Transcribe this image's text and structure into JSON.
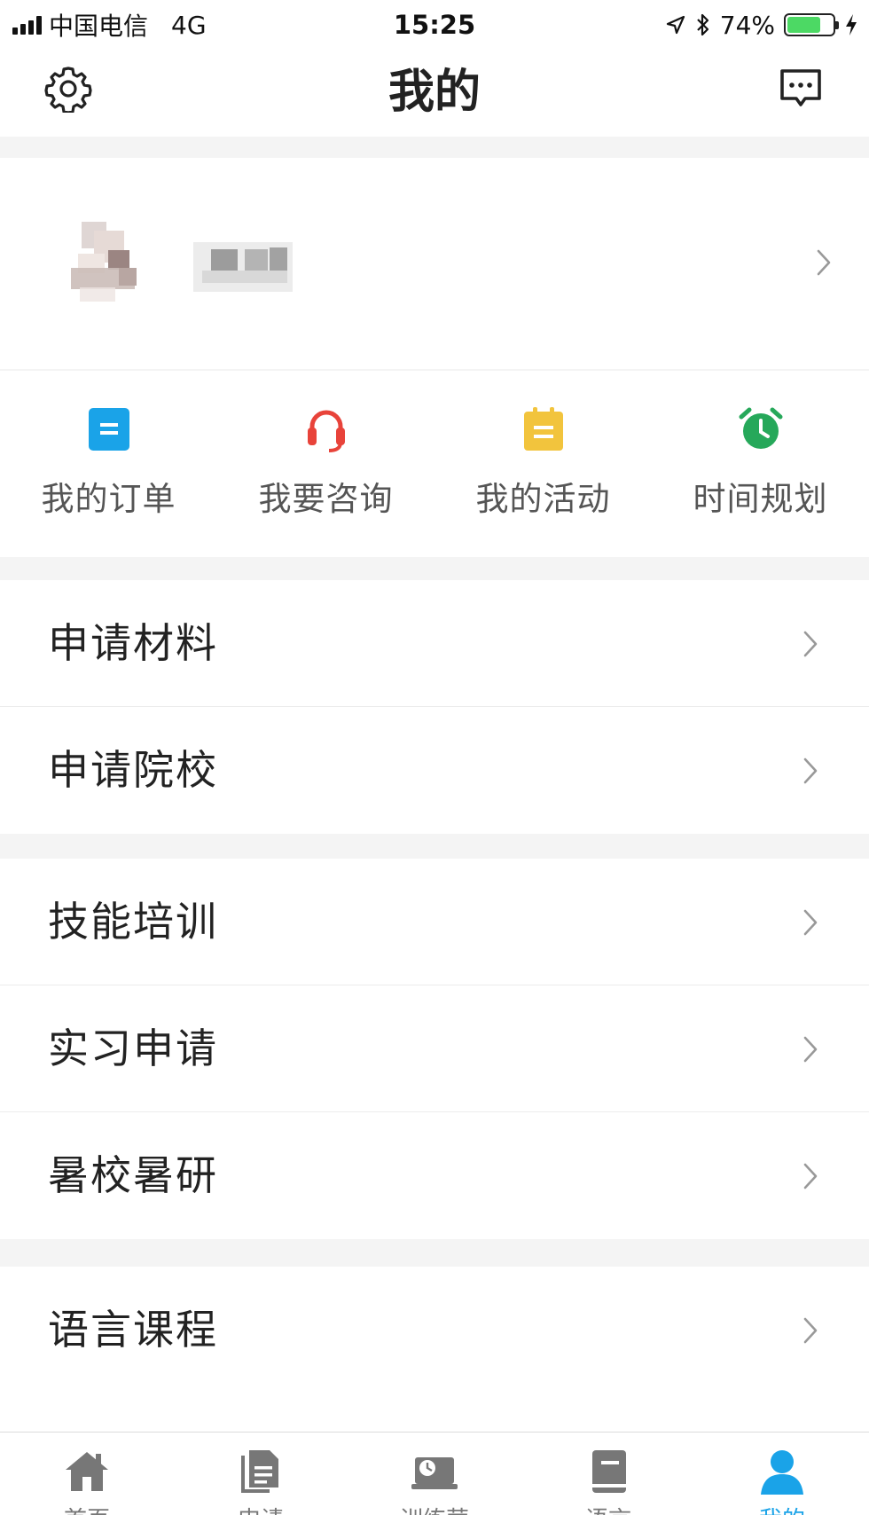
{
  "status_bar": {
    "carrier": "中国电信",
    "network": "4G",
    "time": "15:25",
    "battery": "74%",
    "battery_level": 0.74
  },
  "header": {
    "title": "我的",
    "settings_icon": "gear-icon",
    "message_icon": "message-icon"
  },
  "quick_actions": [
    {
      "label": "我的订单",
      "icon": "order-icon",
      "color": "#1aa3e8"
    },
    {
      "label": "我要咨询",
      "icon": "headset-icon",
      "color": "#e8433a"
    },
    {
      "label": "我的活动",
      "icon": "clipboard-icon",
      "color": "#f2c43d"
    },
    {
      "label": "时间规划",
      "icon": "alarm-clock-icon",
      "color": "#26a85a"
    }
  ],
  "menu_groups": [
    {
      "items": [
        "申请材料",
        "申请院校"
      ]
    },
    {
      "items": [
        "技能培训",
        "实习申请",
        "暑校暑研"
      ]
    },
    {
      "items": [
        "语言课程"
      ]
    }
  ],
  "tabbar": {
    "active_color": "#1aa3e8",
    "tabs": [
      {
        "label": "首页",
        "icon": "home-icon"
      },
      {
        "label": "申请",
        "icon": "document-icon"
      },
      {
        "label": "训练营",
        "icon": "training-icon"
      },
      {
        "label": "语言",
        "icon": "book-icon"
      },
      {
        "label": "我的",
        "icon": "user-icon",
        "active": true
      }
    ]
  }
}
